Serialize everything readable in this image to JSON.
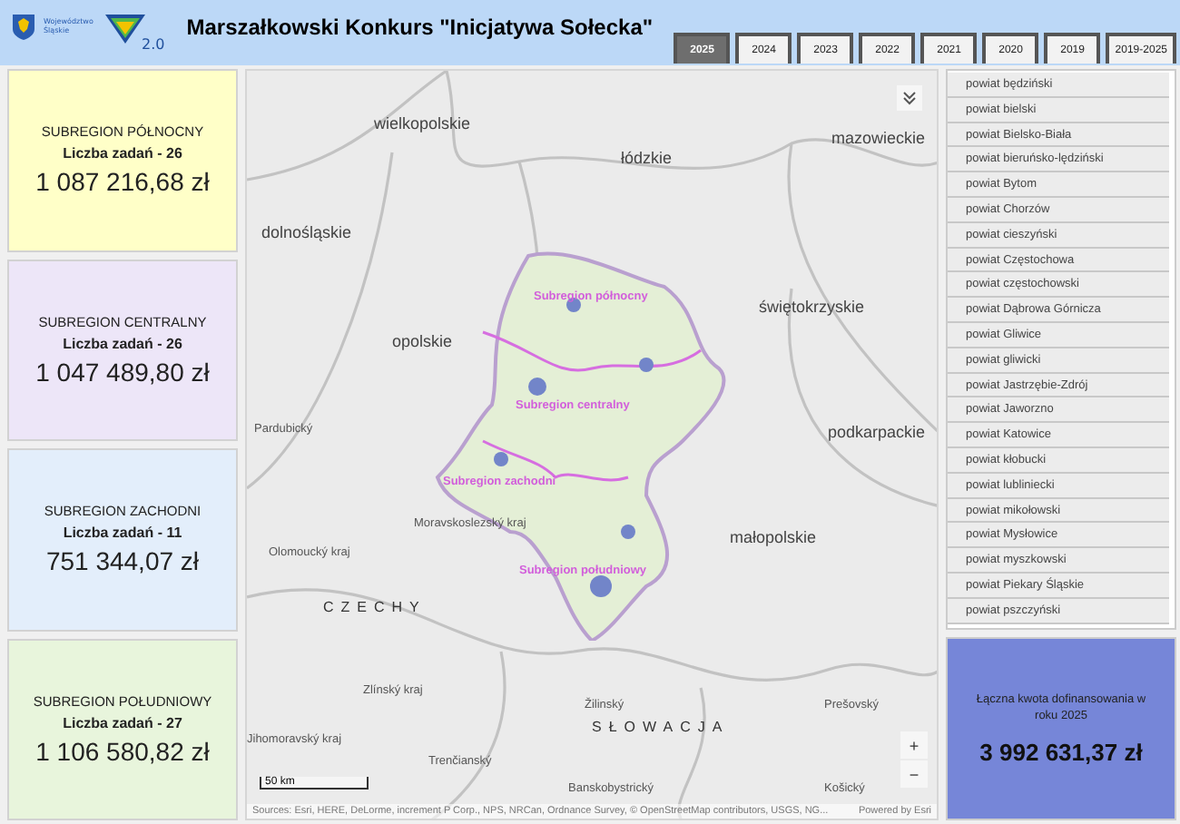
{
  "header": {
    "logo_text": "Województwo Śląskie",
    "logo_version": "2.0",
    "title": "Marszałkowski Konkurs \"Inicjatywa Sołecka\""
  },
  "tabs": [
    {
      "label": "2025",
      "selected": true
    },
    {
      "label": "2024",
      "selected": false
    },
    {
      "label": "2023",
      "selected": false
    },
    {
      "label": "2022",
      "selected": false
    },
    {
      "label": "2021",
      "selected": false
    },
    {
      "label": "2020",
      "selected": false
    },
    {
      "label": "2019",
      "selected": false
    },
    {
      "label": "2019-2025",
      "selected": false
    }
  ],
  "subregions": [
    {
      "name": "SUBREGION PÓŁNOCNY",
      "count": "Liczba zadań - 26",
      "amount": "1 087 216,68 zł",
      "color": "#ffffc8"
    },
    {
      "name": "SUBREGION CENTRALNY",
      "count": "Liczba zadań - 26",
      "amount": "1 047 489,80 zł",
      "color": "#ede6f8"
    },
    {
      "name": "SUBREGION ZACHODNI",
      "count": "Liczba zadań - 11",
      "amount": "751 344,07 zł",
      "color": "#e3eefb"
    },
    {
      "name": "SUBREGION POŁUDNIOWY",
      "count": "Liczba zadań - 27",
      "amount": "1 106 580,82 zł",
      "color": "#e8f5dc"
    }
  ],
  "map": {
    "labels": [
      {
        "text": "wielkopolskie",
        "kind": "region"
      },
      {
        "text": "łódzkie",
        "kind": "region"
      },
      {
        "text": "mazowieckie",
        "kind": "region"
      },
      {
        "text": "dolnośląskie",
        "kind": "region"
      },
      {
        "text": "opolskie",
        "kind": "region"
      },
      {
        "text": "świętokrzyskie",
        "kind": "region"
      },
      {
        "text": "podkarpackie",
        "kind": "region"
      },
      {
        "text": "Pardubický",
        "kind": "minor"
      },
      {
        "text": "Subregion północny",
        "kind": "subregion"
      },
      {
        "text": "Subregion centralny",
        "kind": "subregion"
      },
      {
        "text": "Subregion zachodni",
        "kind": "subregion"
      },
      {
        "text": "Subregion południowy",
        "kind": "subregion"
      },
      {
        "text": "Moravskoslezský kraj",
        "kind": "minor"
      },
      {
        "text": "Olomoucký kraj",
        "kind": "minor"
      },
      {
        "text": "CZECHY",
        "kind": "country"
      },
      {
        "text": "małopolskie",
        "kind": "region"
      },
      {
        "text": "Zlínský kraj",
        "kind": "minor"
      },
      {
        "text": "Žilinský",
        "kind": "minor"
      },
      {
        "text": "SŁOWACJA",
        "kind": "country"
      },
      {
        "text": "Prešovský",
        "kind": "minor"
      },
      {
        "text": "Jihomoravský kraj",
        "kind": "minor"
      },
      {
        "text": "Trenčianský",
        "kind": "minor"
      },
      {
        "text": "Banskobystrický",
        "kind": "minor"
      },
      {
        "text": "Košický",
        "kind": "minor"
      }
    ],
    "scale": "50 km",
    "zoom_in": "+",
    "zoom_out": "−",
    "attribution": "Sources: Esri, HERE, DeLorme, increment P Corp., NPS, NRCan, Ordnance Survey, © OpenStreetMap contributors, USGS, NG...",
    "powered_by": "Powered by Esri"
  },
  "counties": [
    "powiat będziński",
    "powiat bielski",
    "powiat Bielsko-Biała",
    "powiat bieruńsko-lędziński",
    "powiat Bytom",
    "powiat Chorzów",
    "powiat cieszyński",
    "powiat Częstochowa",
    "powiat częstochowski",
    "powiat Dąbrowa Górnicza",
    "powiat Gliwice",
    "powiat gliwicki",
    "powiat Jastrzębie-Zdrój",
    "powiat Jaworzno",
    "powiat Katowice",
    "powiat kłobucki",
    "powiat lubliniecki",
    "powiat mikołowski",
    "powiat Mysłowice",
    "powiat myszkowski",
    "powiat Piekary Śląskie",
    "powiat pszczyński"
  ],
  "total": {
    "label": "Łączna kwota dofinansowania w roku 2025",
    "amount": "3 992 631,37 zł"
  }
}
